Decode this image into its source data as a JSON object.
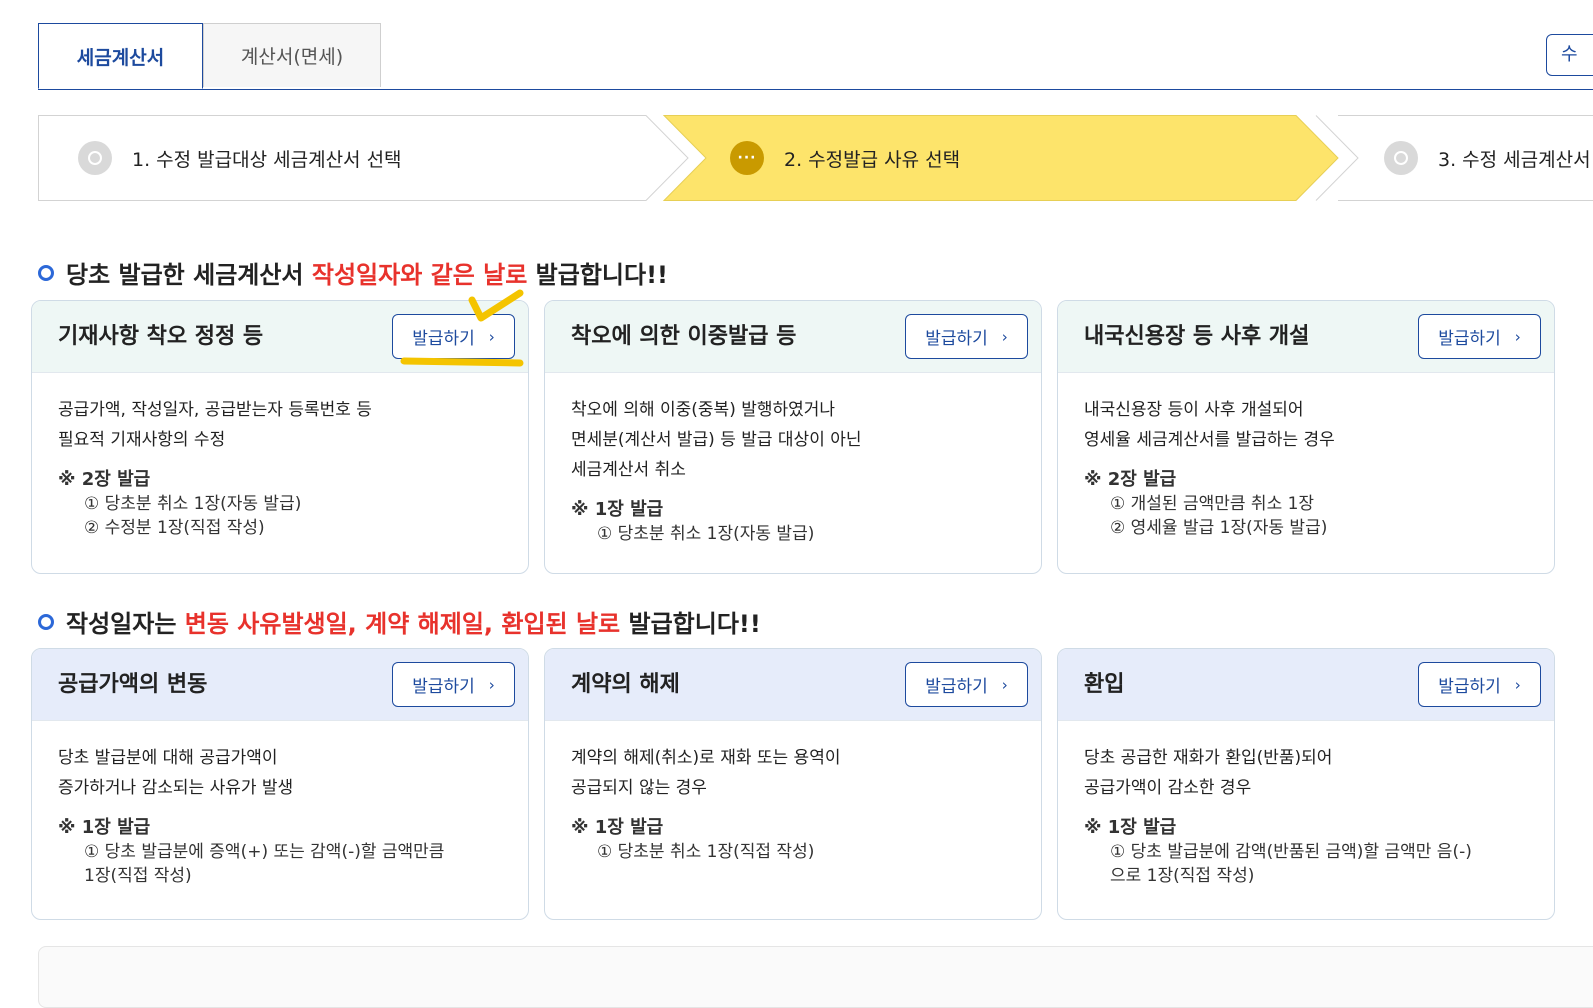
{
  "tabs": [
    {
      "label": "세금계산서",
      "active": true
    },
    {
      "label": "계산서(면세)",
      "active": false
    }
  ],
  "top_right_button": {
    "label": "수"
  },
  "steps": [
    {
      "label": "1. 수정 발급대상 세금계산서 선택",
      "state": "done"
    },
    {
      "label": "2. 수정발급 사유 선택",
      "state": "current",
      "icon": "···"
    },
    {
      "label": "3. 수정 세금계산서",
      "state": "pending"
    }
  ],
  "section1": {
    "prefix": "당초 발급한 세금계산서 ",
    "highlight": "작성일자와 같은 날로",
    "suffix": " 발급합니다!!"
  },
  "section2": {
    "prefix": "작성일자는 ",
    "highlight": "변동 사유발생일, 계약 해제일, 환입된 날로",
    "suffix": " 발급합니다!!"
  },
  "issue_label": "발급하기",
  "cards_row1": [
    {
      "title": "기재사항 착오 정정 등",
      "desc": [
        "공급가액, 작성일자, 공급받는자 등록번호 등",
        "필요적 기재사항의 수정"
      ],
      "note_head": "※ 2장 발급",
      "note_lines": [
        "① 당초분 취소 1장(자동 발급)",
        "② 수정분 1장(직접 작성)"
      ]
    },
    {
      "title": "착오에 의한 이중발급 등",
      "desc": [
        "착오에 의해 이중(중복) 발행하였거나",
        "면세분(계산서 발급) 등 발급 대상이 아닌",
        "세금계산서 취소"
      ],
      "note_head": "※ 1장 발급",
      "note_lines": [
        "① 당초분 취소 1장(자동 발급)"
      ]
    },
    {
      "title": "내국신용장 등 사후 개설",
      "desc": [
        "내국신용장 등이 사후 개설되어",
        "영세율 세금계산서를 발급하는 경우"
      ],
      "note_head": "※ 2장 발급",
      "note_lines": [
        "① 개설된 금액만큼 취소 1장",
        "② 영세율 발급 1장(자동 발급)"
      ]
    }
  ],
  "cards_row2": [
    {
      "title": "공급가액의 변동",
      "desc": [
        "당초 발급분에 대해 공급가액이",
        "증가하거나 감소되는 사유가 발생"
      ],
      "note_head": "※ 1장 발급",
      "note_lines": [
        "① 당초 발급분에 증액(+) 또는 감액(-)할 금액만큼",
        "1장(직접 작성)"
      ]
    },
    {
      "title": "계약의 해제",
      "desc": [
        "계약의 해제(취소)로 재화 또는 용역이",
        "공급되지 않는 경우"
      ],
      "note_head": "※ 1장 발급",
      "note_lines": [
        "① 당초분 취소 1장(직접 작성)"
      ]
    },
    {
      "title": "환입",
      "desc": [
        "당초 공급한 재화가 환입(반품)되어",
        "공급가액이 감소한 경우"
      ],
      "note_head": "※ 1장 발급",
      "note_lines": [
        "① 당초 발급분에 감액(반품된 금액)할 금액만 음(-)",
        "으로 1장(직접 작성)"
      ]
    }
  ],
  "colors": {
    "accent": "#1d4a9e",
    "highlight_red": "#e8322c",
    "step_current": "#fde46b",
    "annotation": "#f4c400"
  }
}
